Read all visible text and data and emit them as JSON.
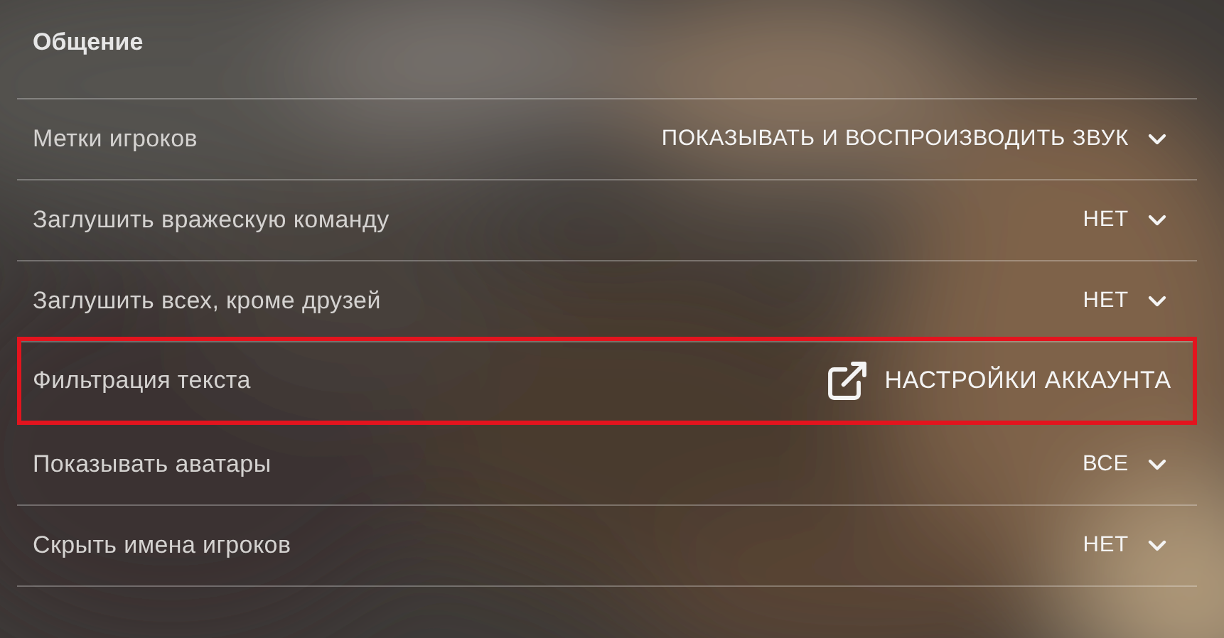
{
  "section_title": "Общение",
  "rows": [
    {
      "label": "Метки игроков",
      "kind": "dropdown",
      "value": "ПОКАЗЫВАТЬ И ВОСПРОИЗВОДИТЬ ЗВУК",
      "highlighted": false
    },
    {
      "label": "Заглушить вражескую команду",
      "kind": "dropdown",
      "value": "НЕТ",
      "highlighted": false
    },
    {
      "label": "Заглушить всех, кроме друзей",
      "kind": "dropdown",
      "value": "НЕТ",
      "highlighted": false
    },
    {
      "label": "Фильтрация текста",
      "kind": "link",
      "value": "НАСТРОЙКИ АККАУНТА",
      "highlighted": true
    },
    {
      "label": "Показывать аватары",
      "kind": "dropdown",
      "value": "ВСЕ",
      "highlighted": false
    },
    {
      "label": "Скрыть имена игроков",
      "kind": "dropdown",
      "value": "НЕТ",
      "highlighted": false
    }
  ]
}
